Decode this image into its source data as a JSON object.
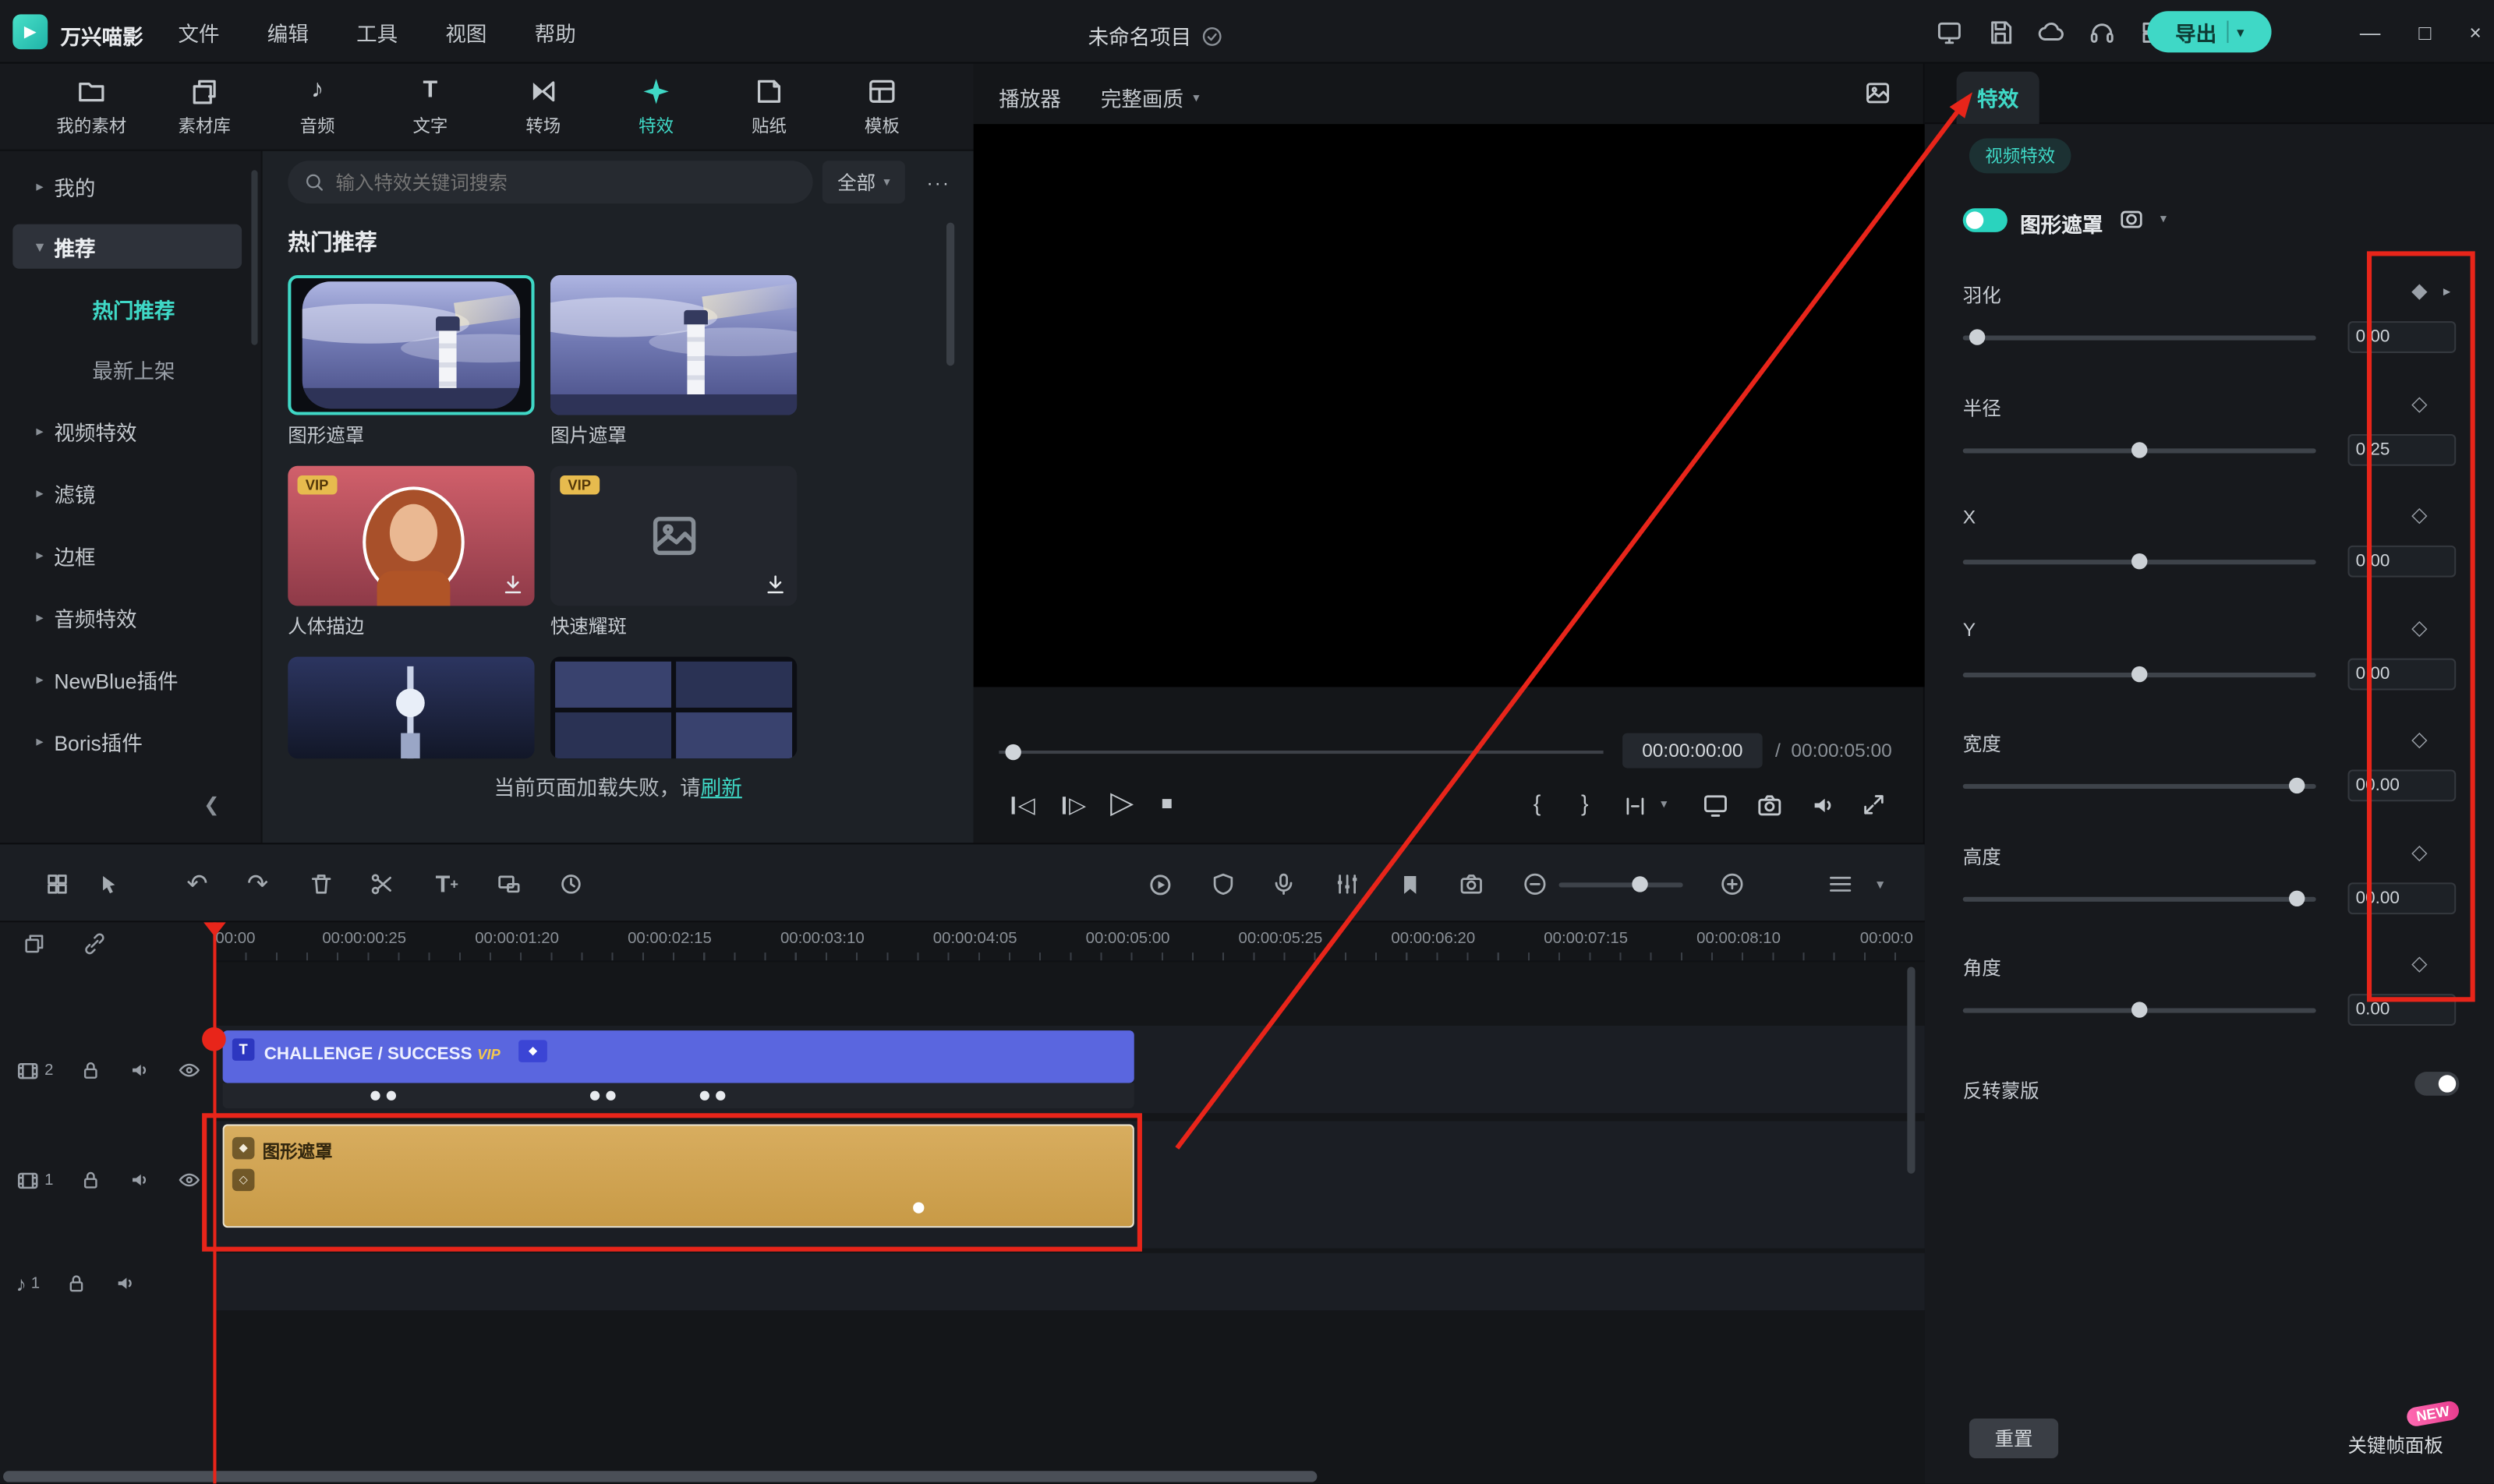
{
  "colors": {
    "accent": "#3fd8c6",
    "annotation_red": "#e8251a",
    "clip_blue": "#5a66df",
    "clip_yellow": "#d0a455",
    "vip_gold": "#e7bb4e"
  },
  "titlebar": {
    "app_name": "万兴喵影",
    "menus": [
      {
        "label": "文件"
      },
      {
        "label": "编辑"
      },
      {
        "label": "工具"
      },
      {
        "label": "视图"
      },
      {
        "label": "帮助"
      }
    ],
    "project_title": "未命名项目",
    "export_label": "导出",
    "window": {
      "minimize": "—",
      "maximize": "□",
      "close": "×"
    }
  },
  "media_tabs": {
    "items": [
      {
        "label": "我的素材"
      },
      {
        "label": "素材库"
      },
      {
        "label": "音频"
      },
      {
        "label": "文字"
      },
      {
        "label": "转场"
      },
      {
        "label": "特效"
      },
      {
        "label": "贴纸"
      },
      {
        "label": "模板"
      }
    ]
  },
  "effects_nav": {
    "items": [
      {
        "label": "我的"
      },
      {
        "label": "推荐"
      },
      {
        "label": "热门推荐"
      },
      {
        "label": "最新上架"
      },
      {
        "label": "视频特效"
      },
      {
        "label": "滤镜"
      },
      {
        "label": "边框"
      },
      {
        "label": "音频特效"
      },
      {
        "label": "NewBlue插件"
      },
      {
        "label": "Boris插件"
      }
    ]
  },
  "effects_browser": {
    "search_placeholder": "输入特效关键词搜索",
    "filter_label": "全部",
    "more_label": "···",
    "section_title": "热门推荐",
    "vip_label": "VIP",
    "items": [
      {
        "name": "图形遮罩"
      },
      {
        "name": "图片遮罩"
      },
      {
        "name": "人体描边",
        "vip": true
      },
      {
        "name": "快速耀斑",
        "vip": true
      }
    ],
    "load_error_text": "当前页面加载失败，请",
    "load_error_link": "刷新"
  },
  "player": {
    "label": "播放器",
    "quality_selected": "完整画质",
    "current_time": "00:00:00:00",
    "time_separator": "/",
    "duration": "00:00:05:00"
  },
  "properties_panel": {
    "tab_label": "特效",
    "category_chip": "视频特效",
    "effect_name": "图形遮罩",
    "params": [
      {
        "label": "羽化",
        "value": "0.00",
        "slider": 0.02
      },
      {
        "label": "半径",
        "value": "0.25",
        "slider": 0.5
      },
      {
        "label": "X",
        "value": "0.00",
        "slider": 0.5
      },
      {
        "label": "Y",
        "value": "0.00",
        "slider": 0.5
      },
      {
        "label": "宽度",
        "value": "00.00",
        "slider": 0.965
      },
      {
        "label": "高度",
        "value": "00.00",
        "slider": 0.965
      },
      {
        "label": "角度",
        "value": "0.00",
        "slider": 0.5
      }
    ],
    "invert_mask_label": "反转蒙版",
    "reset_label": "重置",
    "keyframe_panel_label": "关键帧面板",
    "new_badge": "NEW"
  },
  "timeline": {
    "ruler_labels": [
      {
        "t": "00:00"
      },
      {
        "t": "00:00:00:25"
      },
      {
        "t": "00:00:01:20"
      },
      {
        "t": "00:00:02:15"
      },
      {
        "t": "00:00:03:10"
      },
      {
        "t": "00:00:04:05"
      },
      {
        "t": "00:00:05:00"
      },
      {
        "t": "00:00:05:25"
      },
      {
        "t": "00:00:06:20"
      },
      {
        "t": "00:00:07:15"
      },
      {
        "t": "00:00:08:10"
      },
      {
        "t": "00:00:0"
      }
    ],
    "tracks": [
      {
        "num": "2"
      },
      {
        "num": "1"
      },
      {
        "num": "1"
      }
    ],
    "text_clip_label": "CHALLENGE / SUCCESS",
    "text_clip_vip": "VIP",
    "mask_clip_label": "图形遮罩"
  }
}
